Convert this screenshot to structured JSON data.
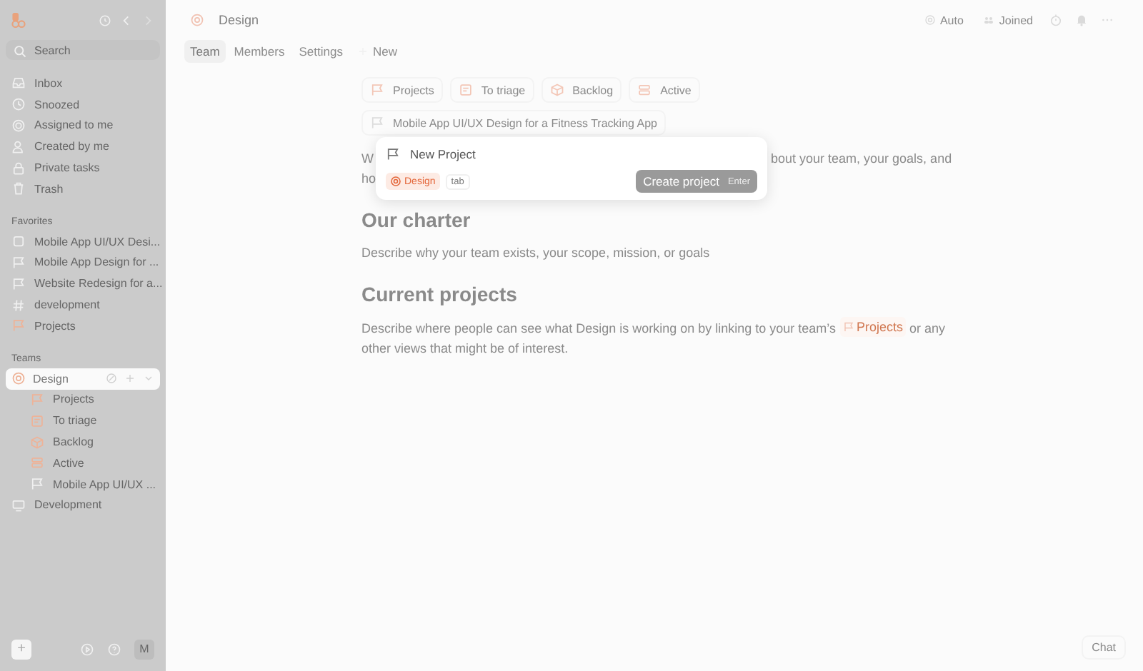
{
  "sidebar": {
    "search": {
      "placeholder": "Search"
    },
    "nav": [
      {
        "label": "Inbox"
      },
      {
        "label": "Snoozed"
      },
      {
        "label": "Assigned to me"
      },
      {
        "label": "Created by me"
      },
      {
        "label": "Private tasks"
      },
      {
        "label": "Trash"
      }
    ],
    "favorites_title": "Favorites",
    "favorites": [
      {
        "label": "Mobile App UI/UX Desi..."
      },
      {
        "label": "Mobile App Design for ..."
      },
      {
        "label": "Website Redesign for a..."
      },
      {
        "label": "development"
      },
      {
        "label": "Projects"
      }
    ],
    "teams_title": "Teams",
    "teams": [
      {
        "label": "Design",
        "selected": true,
        "children": [
          {
            "label": "Projects"
          },
          {
            "label": "To triage"
          },
          {
            "label": "Backlog"
          },
          {
            "label": "Active"
          },
          {
            "label": "Mobile App UI/UX ..."
          }
        ]
      },
      {
        "label": "Development",
        "selected": false
      }
    ],
    "add_button": "+",
    "avatar": "M"
  },
  "header": {
    "title": "Design",
    "auto": "Auto",
    "joined": "Joined"
  },
  "tabs": [
    {
      "label": "Team",
      "selected": true
    },
    {
      "label": "Members",
      "selected": false
    },
    {
      "label": "Settings",
      "selected": false
    },
    {
      "label": "New",
      "selected": false
    }
  ],
  "views": [
    {
      "label": "Projects"
    },
    {
      "label": "To triage"
    },
    {
      "label": "Backlog"
    },
    {
      "label": "Active"
    }
  ],
  "linked_project": "Mobile App UI/UX Design for a Fitness Tracking App",
  "intro": {
    "start": "W",
    "end": "bout your team, your goals, and",
    "line2": "ho"
  },
  "sections": [
    {
      "heading": "Our charter",
      "before": "Describe why your team exists, your scope, mission, or goals"
    },
    {
      "heading": "Current projects",
      "before": "Describe where people can see what Design is working on by linking to your team’s",
      "link": "Projects",
      "after": "or any other views that might be of interest."
    }
  ],
  "dialog": {
    "value": "New Project",
    "team": "Design",
    "hint": "tab",
    "button": "Create project",
    "shortcut": "Enter"
  },
  "chat": "Chat"
}
